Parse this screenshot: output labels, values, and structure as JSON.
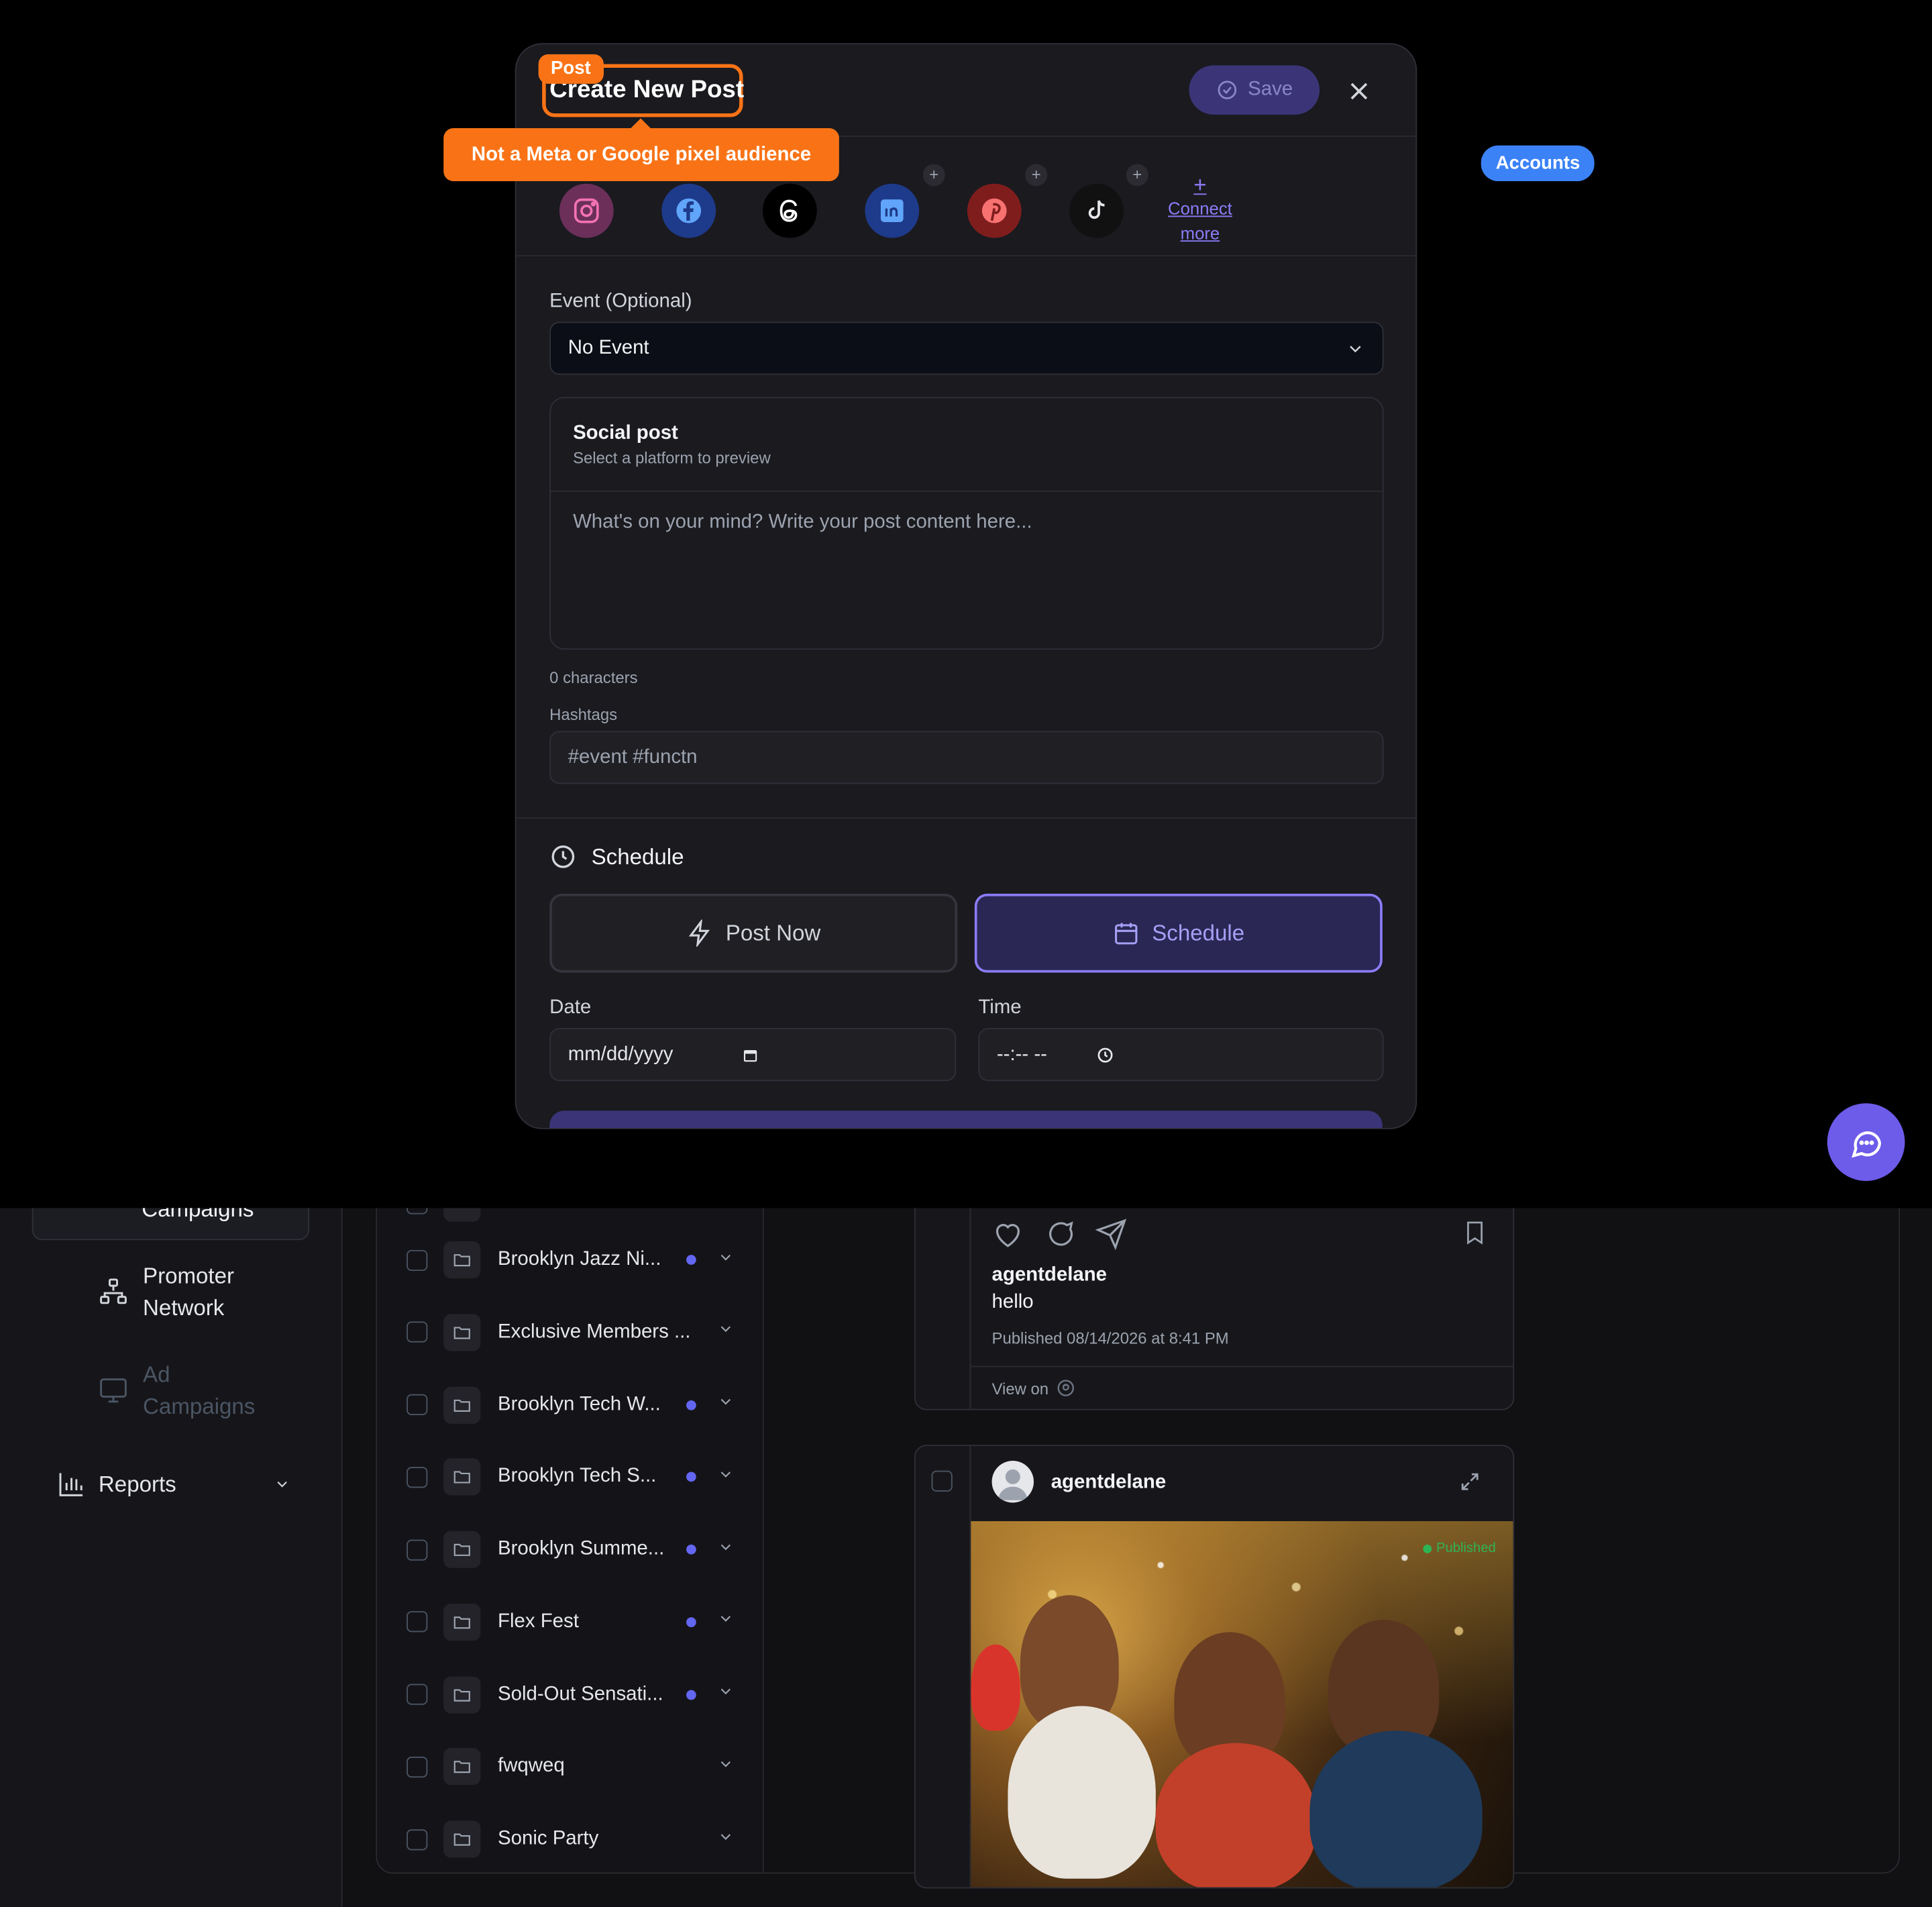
{
  "modal": {
    "title": "Create New Post",
    "save_label": "Save",
    "accounts": [
      {
        "name": "instagram",
        "icon": "instagram-icon"
      },
      {
        "name": "facebook",
        "icon": "facebook-icon"
      },
      {
        "name": "threads",
        "icon": "threads-icon"
      },
      {
        "name": "linkedin",
        "icon": "linkedin-icon"
      },
      {
        "name": "pinterest",
        "icon": "pinterest-icon"
      },
      {
        "name": "tiktok",
        "icon": "tiktok-icon"
      }
    ],
    "connect_more_line1": "Connect",
    "connect_more_line2": "more",
    "event_label": "Event (Optional)",
    "event_value": "No Event",
    "social_post_title": "Social post",
    "social_post_subtitle": "Select a platform to preview",
    "post_placeholder": "What's on your mind? Write your post content here...",
    "char_count": "0 characters",
    "hashtags_label": "Hashtags",
    "hashtags_placeholder": "#event #functn",
    "schedule_heading": "Schedule",
    "post_now_label": "Post Now",
    "schedule_label": "Schedule",
    "date_label": "Date",
    "date_placeholder": "mm/dd/yyyy",
    "time_label": "Time",
    "time_placeholder": "--:-- --"
  },
  "annotations": {
    "tooltip": "Not a Meta or Google pixel audience",
    "post_tag": "Post",
    "accounts_tag": "Accounts"
  },
  "sidebar": {
    "active_item": "Campaigns",
    "items": [
      {
        "label_line1": "Promoter",
        "label_line2": "Network",
        "icon": "network-icon",
        "enabled": true
      },
      {
        "label_line1": "Ad",
        "label_line2": "Campaigns",
        "icon": "monitor-icon",
        "enabled": false
      }
    ],
    "reports_label": "Reports"
  },
  "event_list": [
    {
      "name": "Brooklyn Jazz Ni...",
      "dot": true
    },
    {
      "name": "Exclusive Members ...",
      "dot": false
    },
    {
      "name": "Brooklyn Tech W...",
      "dot": true
    },
    {
      "name": "Brooklyn Tech S...",
      "dot": true
    },
    {
      "name": "Brooklyn Summe...",
      "dot": true
    },
    {
      "name": "Flex Fest",
      "dot": true
    },
    {
      "name": "Sold-Out Sensati...",
      "dot": true
    },
    {
      "name": "fwqweq",
      "dot": false
    },
    {
      "name": "Sonic Party",
      "dot": false
    }
  ],
  "posts": [
    {
      "username": "agentdelane",
      "caption": "hello",
      "published": "Published 08/14/2026 at 8:41 PM",
      "view_on": "View on"
    },
    {
      "username": "agentdelane",
      "status_badge": "Published"
    }
  ],
  "colors": {
    "accent": "#6d5bea",
    "annotation_orange": "#f97316",
    "annotation_blue": "#3b82f6",
    "status_dot": "#6366f1"
  }
}
